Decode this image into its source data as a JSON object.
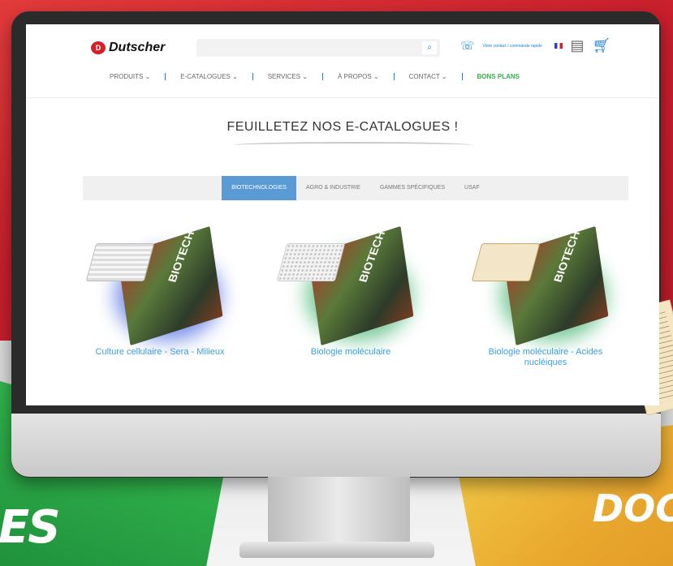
{
  "brand": {
    "name": "Dutscher",
    "mark": "D"
  },
  "header": {
    "search_button": "⌕",
    "support_text": "Votre contact / commande rapide"
  },
  "nav": {
    "items": [
      {
        "label": "PRODUITS ⌄"
      },
      {
        "label": "E-CATALOGUES ⌄"
      },
      {
        "label": "SERVICES ⌄"
      },
      {
        "label": "À PROPOS ⌄"
      },
      {
        "label": "CONTACT ⌄"
      },
      {
        "label": "BONS PLANS"
      }
    ]
  },
  "main": {
    "heading": "FEUILLETEZ NOS E-CATALOGUES !",
    "tabs": [
      {
        "label": "BIOTECHNOLOGIES"
      },
      {
        "label": "AGRO & INDUSTRIE"
      },
      {
        "label": "GAMMES SPÉCIFIQUES"
      },
      {
        "label": "USAF"
      }
    ],
    "catalogues": [
      {
        "label": "Culture cellulaire - Sera - Milieux",
        "cover": "BIOTECH",
        "accent": "#3f5fe0"
      },
      {
        "label": "Biologie moléculaire",
        "cover": "BIOTECH",
        "accent": "#38b06a"
      },
      {
        "label": "Biologie moléculaire - Acides nucléiques",
        "cover": "BIOTECH",
        "accent": "#38b06a"
      }
    ]
  },
  "backdrop": {
    "left_word": "ES",
    "right_word": "DOCU"
  },
  "colors": {
    "accent": "#1a7fd4",
    "brand_red": "#d61f26",
    "tab_active": "#5b9bd5",
    "link": "#3da0e0"
  }
}
